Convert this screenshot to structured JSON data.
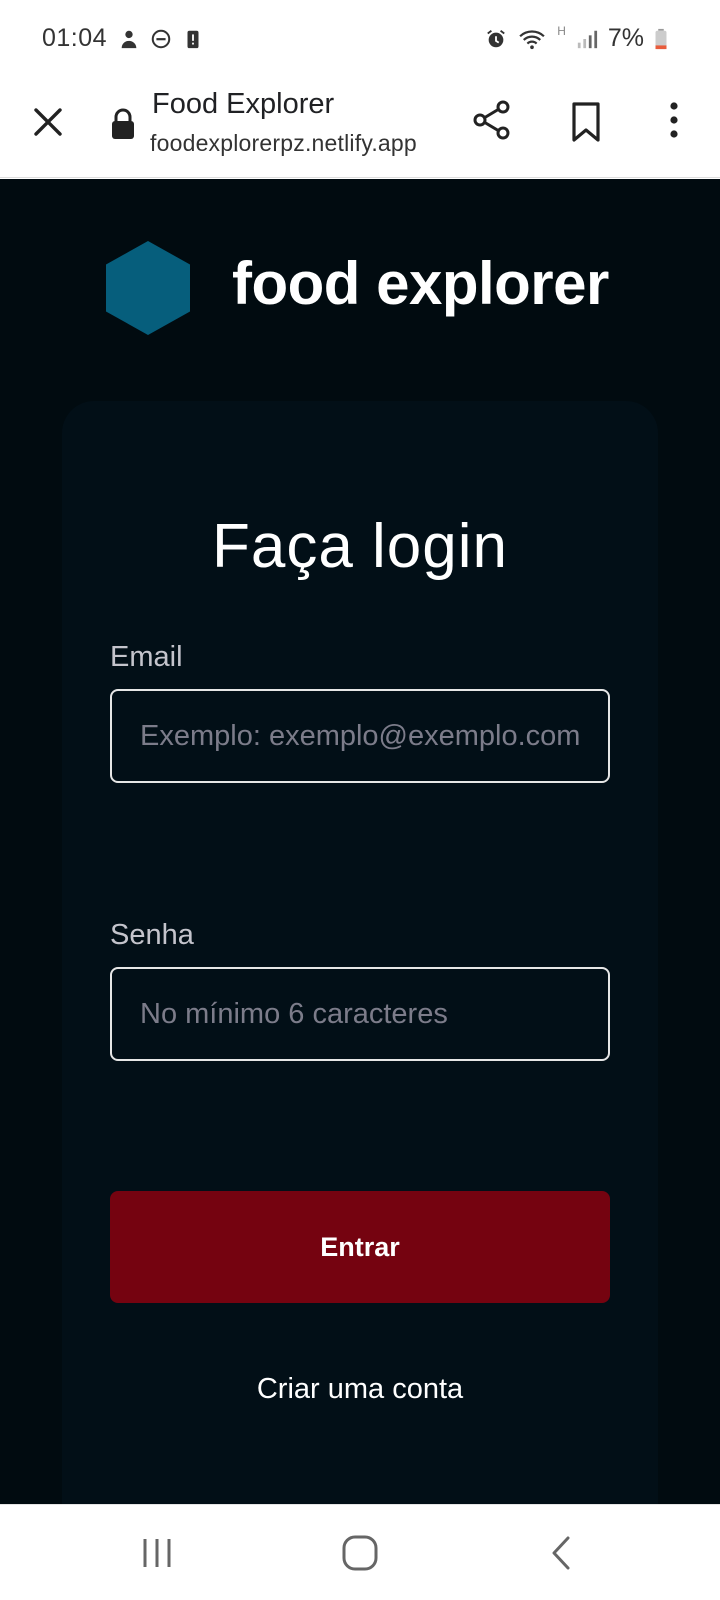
{
  "status_bar": {
    "time": "01:04",
    "network_type": "H",
    "battery": "7%"
  },
  "browser": {
    "title": "Food Explorer",
    "url": "foodexplorerpz.netlify.app"
  },
  "app": {
    "logo_text": "food explorer",
    "colors": {
      "background": "#010b10",
      "card": "#020f17",
      "logo_hex": "#065e7c",
      "button": "#750310"
    },
    "login": {
      "title": "Faça login",
      "email_label": "Email",
      "email_placeholder": "Exemplo: exemplo@exemplo.com.br",
      "password_label": "Senha",
      "password_placeholder": "No mínimo 6 caracteres",
      "submit_label": "Entrar",
      "create_account_label": "Criar uma conta"
    }
  }
}
